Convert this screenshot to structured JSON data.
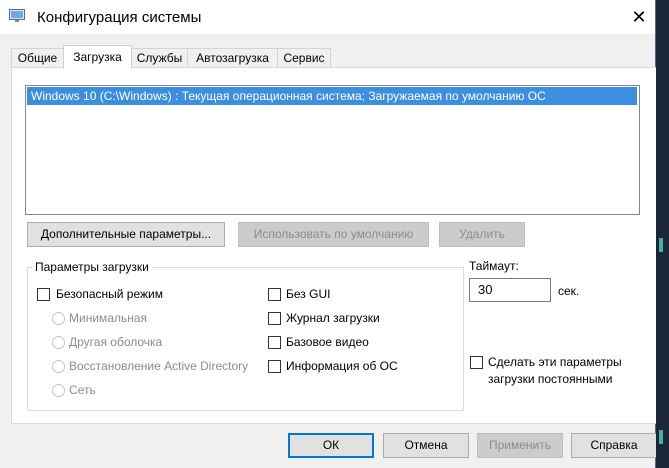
{
  "window": {
    "title": "Конфигурация системы"
  },
  "tabs": [
    {
      "label": "Общие",
      "active": false
    },
    {
      "label": "Загрузка",
      "active": true
    },
    {
      "label": "Службы",
      "active": false
    },
    {
      "label": "Автозагрузка",
      "active": false
    },
    {
      "label": "Сервис",
      "active": false
    }
  ],
  "os_list": {
    "items": [
      {
        "text": "Windows 10 (C:\\Windows) : Текущая операционная система; Загружаемая по умолчанию ОС",
        "selected": true
      }
    ]
  },
  "list_buttons": {
    "advanced": "Дополнительные параметры...",
    "set_default": "Использовать по умолчанию",
    "delete": "Удалить"
  },
  "boot_options": {
    "label": "Параметры загрузки",
    "safe_mode": {
      "label": "Безопасный режим",
      "checked": false
    },
    "safe_mode_types": [
      "Минимальная",
      "Другая оболочка",
      "Восстановление Active Directory",
      "Сеть"
    ],
    "no_gui": {
      "label": "Без GUI",
      "checked": false
    },
    "boot_log": {
      "label": "Журнал загрузки",
      "checked": false
    },
    "base_video": {
      "label": "Базовое видео",
      "checked": false
    },
    "os_info": {
      "label": "Информация  об ОС",
      "checked": false
    }
  },
  "timeout": {
    "label": "Таймаут:",
    "value": "30",
    "unit": "сек."
  },
  "permanent": {
    "label_line1": "Сделать эти параметры",
    "label_line2": "загрузки постоянными",
    "checked": false
  },
  "dialog_buttons": {
    "ok": "ОК",
    "cancel": "Отмена",
    "apply": "Применить",
    "help": "Справка"
  },
  "colors": {
    "selection": "#3c8fe0",
    "default_button_border": "#0078d7"
  }
}
